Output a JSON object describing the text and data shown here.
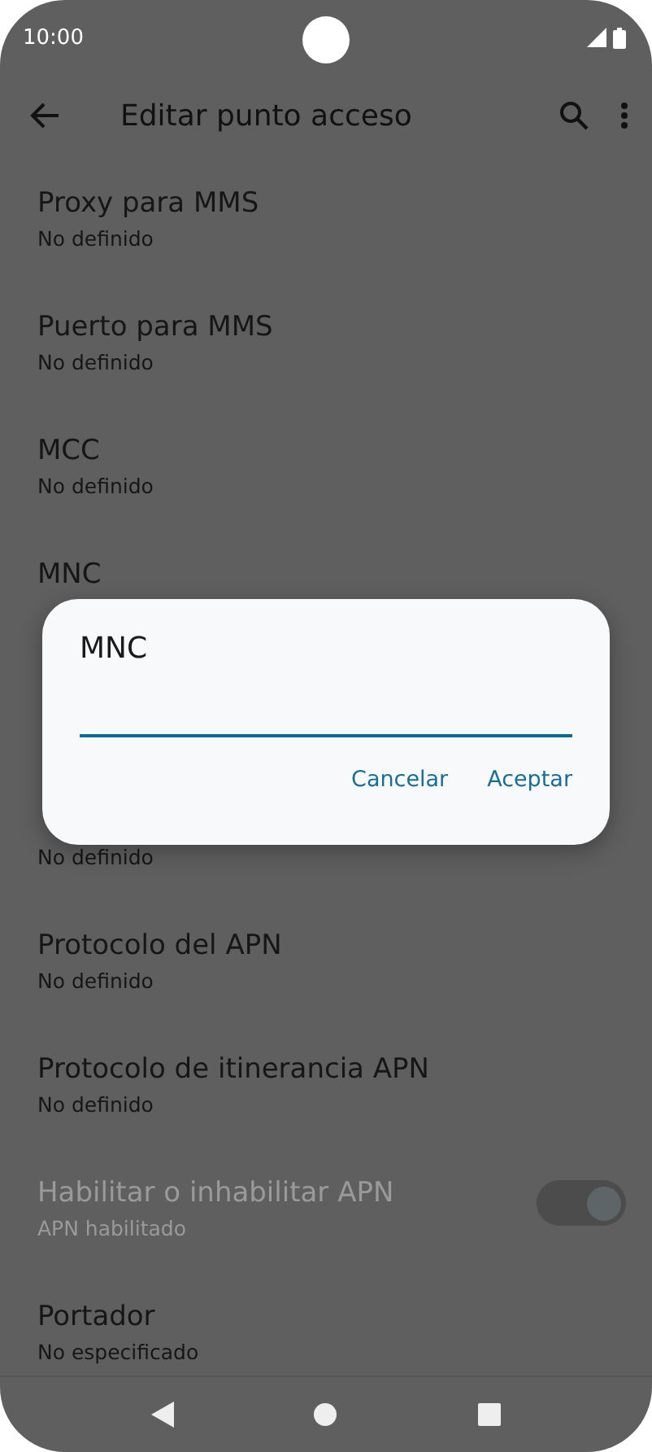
{
  "status_bar": {
    "time": "10:00"
  },
  "toolbar": {
    "title": "Editar punto acceso"
  },
  "settings": [
    {
      "title": "Proxy para MMS",
      "summary": "No definido",
      "disabled": false
    },
    {
      "title": "Puerto para MMS",
      "summary": "No definido",
      "disabled": false
    },
    {
      "title": "MCC",
      "summary": "No definido",
      "disabled": false
    },
    {
      "title": "MNC",
      "disabled": false
    },
    {
      "summary": "No definido",
      "disabled": false
    },
    {
      "title": "Protocolo del APN",
      "summary": "No definido",
      "disabled": false
    },
    {
      "title": "Protocolo de itinerancia APN",
      "summary": "No definido",
      "disabled": false
    },
    {
      "title": "Habilitar o inhabilitar APN",
      "summary": "APN habilitado",
      "disabled": true,
      "kind": "switch",
      "on": true
    },
    {
      "title": "Portador",
      "summary": "No especificado",
      "disabled": false
    }
  ],
  "dialog": {
    "title": "MNC",
    "buttons": [
      "Cancelar",
      "Aceptar"
    ]
  }
}
